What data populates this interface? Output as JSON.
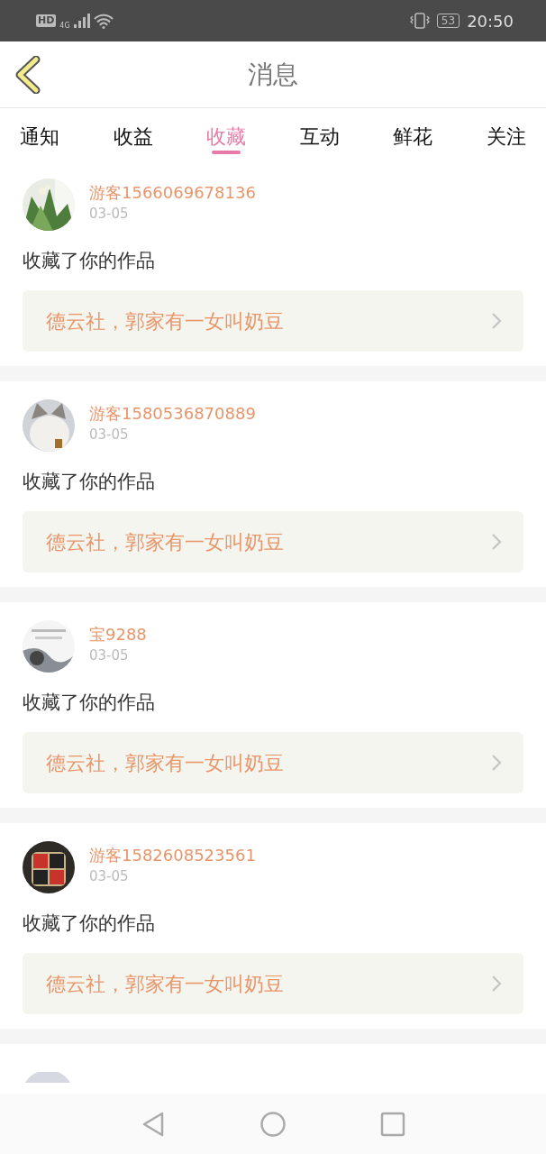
{
  "status_bar": {
    "hd": "HD",
    "network": "4G",
    "battery": "53",
    "time": "20:50"
  },
  "header": {
    "title": "消息"
  },
  "tabs": [
    {
      "label": "通知",
      "selected": false
    },
    {
      "label": "收益",
      "selected": false
    },
    {
      "label": "收藏",
      "selected": true
    },
    {
      "label": "互动",
      "selected": false
    },
    {
      "label": "鲜花",
      "selected": false
    },
    {
      "label": "关注",
      "selected": false
    }
  ],
  "messages": [
    {
      "user": "游客1566069678136",
      "date": "03-05",
      "action": "收藏了你的作品",
      "work": "德云社，郭家有一女叫奶豆"
    },
    {
      "user": "游客1580536870889",
      "date": "03-05",
      "action": "收藏了你的作品",
      "work": "德云社，郭家有一女叫奶豆"
    },
    {
      "user": "宝9288",
      "date": "03-05",
      "action": "收藏了你的作品",
      "work": "德云社，郭家有一女叫奶豆"
    },
    {
      "user": "游客1582608523561",
      "date": "03-05",
      "action": "收藏了你的作品",
      "work": "德云社，郭家有一女叫奶豆"
    }
  ]
}
